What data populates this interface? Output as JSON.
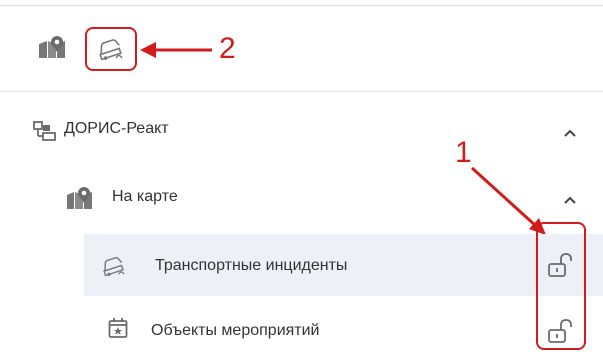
{
  "toolbar": {
    "map_layers_icon": "map-layers-icon",
    "incident_toggle_icon": "car-incident-icon"
  },
  "annotations": {
    "label_1": "1",
    "label_2": "2",
    "color": "#d21b1b"
  },
  "tree": {
    "root": {
      "label": "ДОРИС-Реакт",
      "icon": "hierarchy-icon",
      "expanded": true
    },
    "group": {
      "label": "На карте",
      "icon": "map-pin-icon",
      "expanded": true
    },
    "items": [
      {
        "label": "Транспортные инциденты",
        "icon": "car-incident-icon",
        "action_icon": "unlock-icon",
        "selected": true
      },
      {
        "label": "Объекты мероприятий",
        "icon": "calendar-star-icon",
        "action_icon": "unlock-icon",
        "selected": false
      }
    ]
  },
  "colors": {
    "selected_row_bg": "#eef0f7",
    "icon_gray": "#6b6b6b",
    "text": "#333333"
  }
}
